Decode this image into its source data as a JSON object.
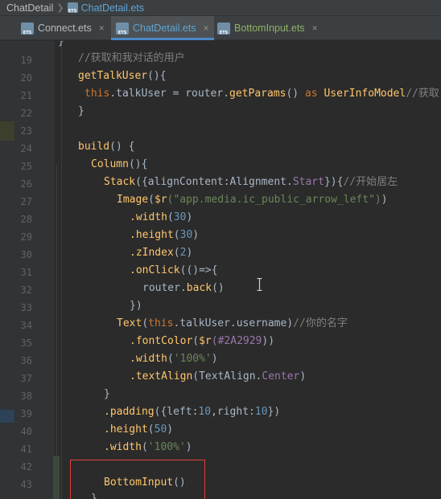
{
  "breadcrumb": {
    "root": "ChatDetail",
    "file": "ChatDetail.ets"
  },
  "tabs": [
    {
      "label": "Connect.ets",
      "active": false,
      "close": "×"
    },
    {
      "label": "ChatDetail.ets",
      "active": true,
      "close": "×"
    },
    {
      "label": "BottomInput.ets",
      "active": false,
      "close": "×"
    }
  ],
  "editor": {
    "line_numbers": [
      "19",
      "20",
      "21",
      "22",
      "23",
      "24",
      "25",
      "26",
      "27",
      "28",
      "29",
      "30",
      "31",
      "32",
      "33",
      "34",
      "35",
      "36",
      "37",
      "38",
      "39",
      "40",
      "41",
      "42",
      "43"
    ],
    "top_fragment": "}",
    "bottom_fragment": "}",
    "code": {
      "l19_comment": "//获取和我对话的用户",
      "l20_fn": "getTalkUser",
      "l20_rest": "(){",
      "l21_this": "this",
      "l21_a": ".talkUser = router.",
      "l21_call": "getParams",
      "l21_b": "() ",
      "l21_as": "as",
      "l21_type": " UserInfoModel",
      "l21_comment": "//获取",
      "l22": "}",
      "l24_fn": "build",
      "l24_rest": "() {",
      "l25_fn": "Column",
      "l25_rest": "(){",
      "l26_fn": "Stack",
      "l26_a": "({alignContent:Alignment.",
      "l26_b": "Start",
      "l26_c": "}){",
      "l26_comment": "//开始居左",
      "l27_fn": "Image",
      "l27_a": "(",
      "l27_r": "$r",
      "l27_str": "(\"app.media.ic_public_arrow_left\")",
      "l27_b": ")",
      "l28_m": ".width",
      "l28_num": "30",
      "l29_m": ".height",
      "l29_num": "30",
      "l30_m": ".zIndex",
      "l30_num": "2",
      "l31_m": ".onClick",
      "l31_rest": "(()=>{",
      "l32_a": "router.",
      "l32_m": "back",
      "l32_b": "()",
      "l33": "})",
      "l34_fn": "Text",
      "l34_a": "(",
      "l34_this": "this",
      "l34_b": ".talkUser.username)",
      "l34_comment": "//你的名字",
      "l35_m": ".fontColor",
      "l35_a": "(",
      "l35_r": "$r",
      "l35_str": "(#2A2929",
      "l35_b": "))",
      "l36_m": ".width",
      "l36_str": "'100%'",
      "l37_m": ".textAlign",
      "l37_rest": "(TextAlign.",
      "l37_c": "Center",
      "l37_end": ")",
      "l38": "}",
      "l39_m": ".padding",
      "l39_a": "({left:",
      "l39_n1": "10",
      "l39_b": ",right:",
      "l39_n2": "10",
      "l39_c": "})",
      "l40_m": ".height",
      "l40_num": "50",
      "l41_m": ".width",
      "l41_str": "'100%'",
      "l43_fn": "BottomInput",
      "l43_rest": "()"
    }
  },
  "colors": {
    "keyword": "#cc7832",
    "function": "#ffc66d",
    "string": "#6a8759",
    "number": "#6897bb",
    "comment": "#808080",
    "field": "#9876aa",
    "highlight_box": "#e0403a",
    "active_tab_underline": "#4a88c7"
  }
}
